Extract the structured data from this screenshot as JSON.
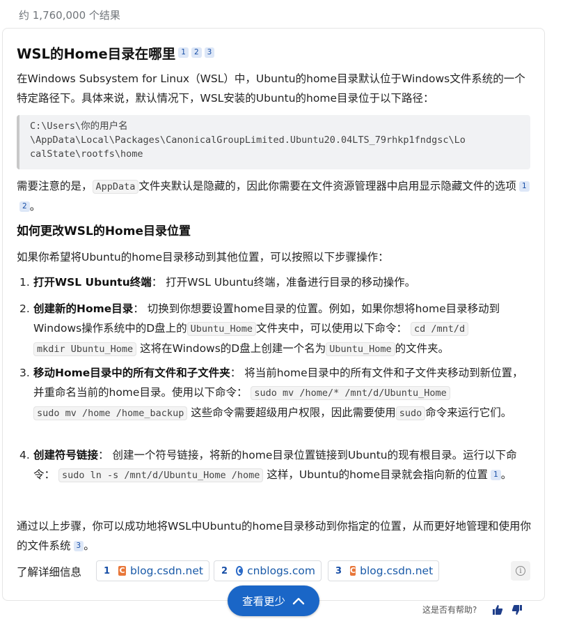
{
  "results_count": "约 1,760,000 个结果",
  "answer": {
    "title": "WSL的Home目录在哪里",
    "title_citations": [
      "1",
      "2",
      "3"
    ],
    "intro": "在Windows Subsystem for Linux（WSL）中，Ubuntu的home目录默认位于Windows文件系统的一个特定路径下。具体来说，默认情况下，WSL安装的Ubuntu的home目录位于以下路径：",
    "code_lines": [
      "C:\\Users\\你的用户名",
      "\\AppData\\Local\\Packages\\CanonicalGroupLimited.Ubuntu20.04LTS_79rhkp1fndgsc\\Lo",
      "calState\\rootfs\\home"
    ],
    "note_before": "需要注意的是，",
    "note_code": "AppData",
    "note_after": "文件夹默认是隐藏的，因此你需要在文件资源管理器中启用显示隐藏文件的选项",
    "note_citations": [
      "1",
      "2"
    ],
    "note_end": "。",
    "section_title": "如何更改WSL的Home目录位置",
    "steps_intro": "如果你希望将Ubuntu的home目录移动到其他位置，可以按照以下步骤操作：",
    "steps": [
      {
        "num": "1.",
        "title": "打开WSL Ubuntu终端",
        "text": "：  打开WSL Ubuntu终端，准备进行目录的移动操作。"
      },
      {
        "num": "2.",
        "title": "创建新的Home目录",
        "text_a": "：  切换到你想要设置home目录的位置。例如，如果你想将home目录移动到Windows操作系统中的D盘上的",
        "code_a": "Ubuntu_Home",
        "text_b": "文件夹中，可以使用以下命令：",
        "code_b1": "cd /mnt/d",
        "code_b2": "mkdir Ubuntu_Home",
        "text_c": "这将在Windows的D盘上创建一个名为",
        "code_c": "Ubuntu_Home",
        "text_d": "的文件夹。"
      },
      {
        "num": "3.",
        "title": "移动Home目录中的所有文件和子文件夹",
        "text_a": "：  将当前home目录中的所有文件和子文件夹移动到新位置，并重命名当前的home目录。使用以下命令：",
        "code_a1": "sudo mv /home/* /mnt/d/Ubuntu_Home",
        "code_a2": "sudo mv /home /home_backup",
        "text_b": "这些命令需要超级用户权限，因此需要使用",
        "code_b": "sudo",
        "text_c": "命令来运行它们。"
      },
      {
        "num": "4.",
        "title": "创建符号链接",
        "text_a": "：  创建一个符号链接，将新的home目录位置链接到Ubuntu的现有根目录。运行以下命令：",
        "code_a": "sudo ln -s /mnt/d/Ubuntu_Home /home",
        "text_b": "这样，Ubuntu的home目录就会指向新的位置",
        "citation": "1",
        "text_c": "。"
      }
    ],
    "outro": "通过以上步骤，你可以成功地将WSL中Ubuntu的home目录移动到你指定的位置，从而更好地管理和使用你的文件系统",
    "outro_citation": "3",
    "outro_end": "。",
    "learn_more_label": "了解详细信息",
    "sources": [
      {
        "num": "1",
        "name": "blog.csdn.net",
        "icon": "csdn-favicon-icon"
      },
      {
        "num": "2",
        "name": "cnblogs.com",
        "icon": "cnblogs-favicon-icon"
      },
      {
        "num": "3",
        "name": "blog.csdn.net",
        "icon": "csdn-favicon-icon"
      }
    ],
    "info_glyph": "i"
  },
  "collapse_button_label": "查看更少",
  "feedback_prompt": "这是否有帮助?",
  "colors": {
    "accent_blue": "#1a66c7",
    "citation_bg": "#dde7f7",
    "link": "#1a5aa8"
  }
}
